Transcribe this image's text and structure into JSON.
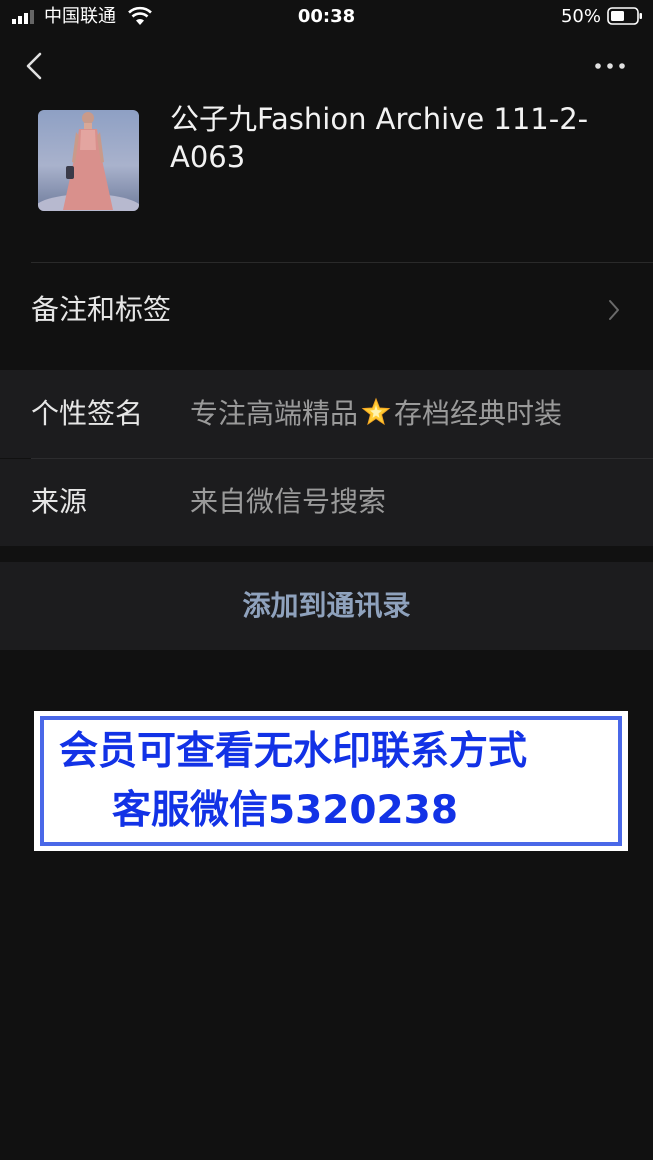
{
  "status_bar": {
    "carrier": "中国联通",
    "time": "00:38",
    "battery": "50%"
  },
  "nav": {
    "back_icon": "chevron-left-icon",
    "more_icon": "ellipsis-icon"
  },
  "profile": {
    "name": "公子九Fashion Archive 111-2-A063",
    "avatar": "fashion-photo"
  },
  "rows": {
    "remark_label": "备注和标签",
    "signature_label": "个性签名",
    "signature_value_before": "专注高端精品",
    "signature_emoji": "glowing-star-icon",
    "signature_value_after": "存档经典时装",
    "source_label": "来源",
    "source_value": "来自微信号搜索"
  },
  "actions": {
    "add_contact": "添加到通讯录"
  },
  "banner": {
    "line1": "会员可查看无水印联系方式",
    "line2": "客服微信5320238"
  },
  "colors": {
    "background": "#111111",
    "cell": "#1c1c1e",
    "action_text": "#8fa2bd",
    "banner_text": "#1232e6",
    "banner_border": "#4a68e8"
  }
}
